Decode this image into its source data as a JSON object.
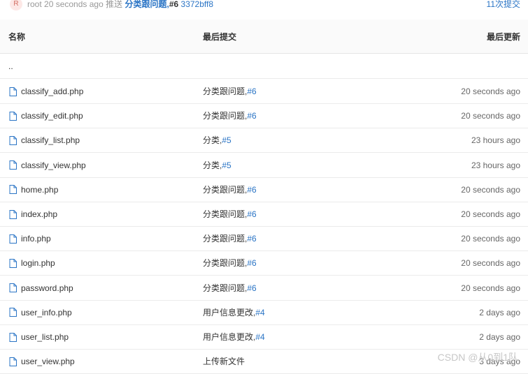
{
  "commit_bar": {
    "avatar_letter": "R",
    "user": "root",
    "time": "20 seconds ago",
    "action": "推送",
    "message": "分类跟问题,",
    "issue": "#6",
    "hash": "3372bff8",
    "commit_count": "11次提交"
  },
  "table": {
    "headers": {
      "name": "名称",
      "last_commit": "最后提交",
      "last_update": "最后更新"
    },
    "parent_dir": "..",
    "rows": [
      {
        "name": "classify_add.php",
        "commit": "分类跟问题,",
        "issue": "#6",
        "time": "20 seconds ago"
      },
      {
        "name": "classify_edit.php",
        "commit": "分类跟问题,",
        "issue": "#6",
        "time": "20 seconds ago"
      },
      {
        "name": "classify_list.php",
        "commit": "分类,",
        "issue": "#5",
        "time": "23 hours ago"
      },
      {
        "name": "classify_view.php",
        "commit": "分类,",
        "issue": "#5",
        "time": "23 hours ago"
      },
      {
        "name": "home.php",
        "commit": "分类跟问题,",
        "issue": "#6",
        "time": "20 seconds ago"
      },
      {
        "name": "index.php",
        "commit": "分类跟问题,",
        "issue": "#6",
        "time": "20 seconds ago"
      },
      {
        "name": "info.php",
        "commit": "分类跟问题,",
        "issue": "#6",
        "time": "20 seconds ago"
      },
      {
        "name": "login.php",
        "commit": "分类跟问题,",
        "issue": "#6",
        "time": "20 seconds ago"
      },
      {
        "name": "password.php",
        "commit": "分类跟问题,",
        "issue": "#6",
        "time": "20 seconds ago"
      },
      {
        "name": "user_info.php",
        "commit": "用户信息更改,",
        "issue": "#4",
        "time": "2 days ago"
      },
      {
        "name": "user_list.php",
        "commit": "用户信息更改,",
        "issue": "#4",
        "time": "2 days ago"
      },
      {
        "name": "user_view.php",
        "commit": "上传新文件",
        "issue": "",
        "time": "3 days ago"
      }
    ]
  },
  "watermark": "CSDN @从0到1队",
  "colors": {
    "link": "#2a74c5",
    "border": "#ebebeb",
    "header_bg": "#fafafa"
  }
}
